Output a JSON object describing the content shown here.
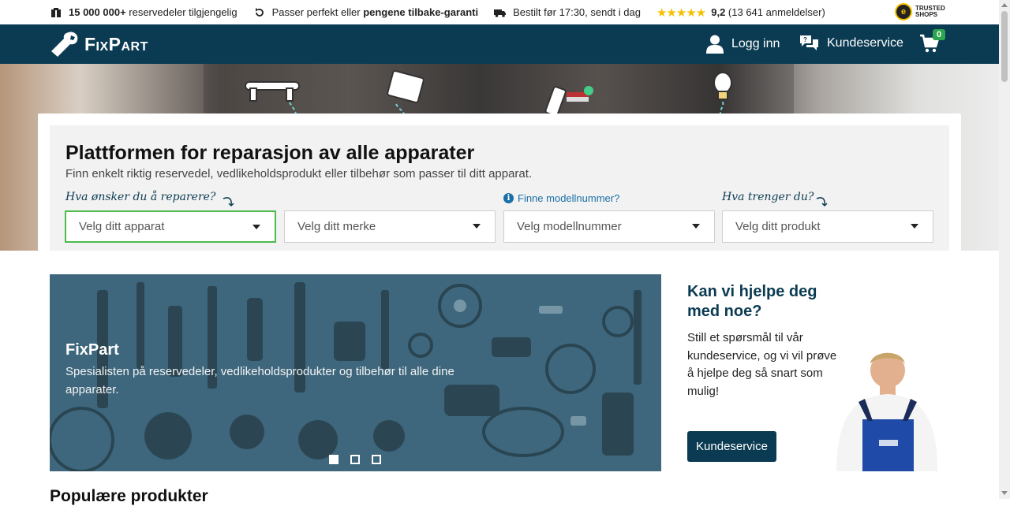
{
  "usp": {
    "parts_count": "15 000 000+",
    "parts_text": " reservedeler tilgjengelig",
    "guarantee_prefix": "Passer perfekt eller ",
    "guarantee_bold": "pengene tilbake-garanti",
    "shipping": "Bestilt før 17:30, sendt i dag",
    "rating_value": "9,2",
    "rating_count": " (13 641 anmeldelser)",
    "trusted_line1": "TRUSTED",
    "trusted_line2": "SHOPS"
  },
  "nav": {
    "logo": "FixPart",
    "login": "Logg inn",
    "customer_service": "Kundeservice",
    "cart_count": "0"
  },
  "hero": {
    "title": "Plattformen for reparasjon av alle apparater",
    "subtitle": "Finn enkelt riktig reservedel, vedlikeholdsprodukt eller tilbehør som passer til ditt apparat.",
    "hint_repair": "Hva ønsker du å reparere?",
    "hint_model": "Finne modellnummer?",
    "hint_need": "Hva trenger du?",
    "selects": [
      "Velg ditt apparat",
      "Velg ditt merke",
      "Velg modellnummer",
      "Velg ditt produkt"
    ]
  },
  "banner": {
    "title": "FixPart",
    "text": "Spesialisten på reservedeler, vedlikeholdsprodukter og tilbehør til alle dine apparater."
  },
  "help": {
    "title": "Kan vi hjelpe deg med noe?",
    "text": "Still et spørsmål til vår kundeservice, og vi vil prøve å hjelpe deg så snart som mulig!",
    "button": "Kundeservice"
  },
  "sections": {
    "popular": "Populære produkter"
  },
  "colors": {
    "brand": "#0b3b52",
    "active_border": "#4cbb4c",
    "cart_badge": "#2da44e",
    "stars": "#f6c000"
  }
}
